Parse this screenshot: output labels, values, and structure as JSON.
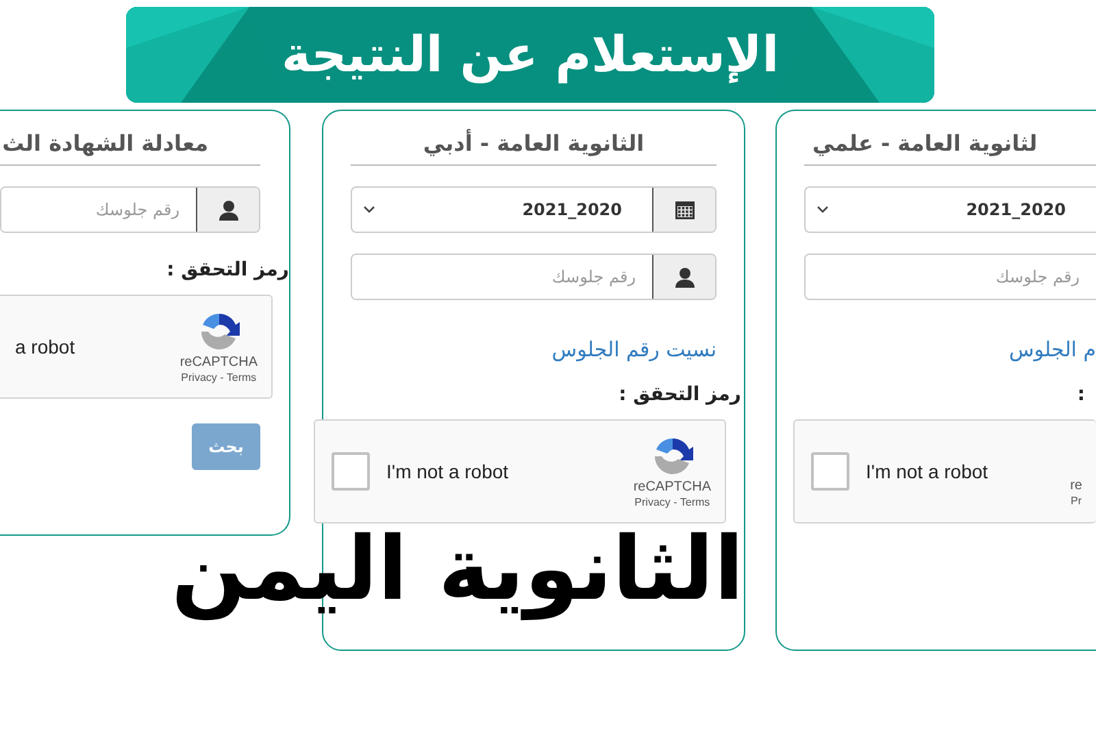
{
  "banner": {
    "title": "الإستعلام عن النتيجة"
  },
  "cards": [
    {
      "title": "لثانوية العامة - علمي",
      "year": "2021_2020",
      "seat_placeholder": "رقم جلوسك",
      "forgot_link": "م الجلوس",
      "captcha_label": ":",
      "captcha": {
        "checked": false,
        "text": "I'm not a robot",
        "logo": false,
        "brand": "re",
        "links": "Pr"
      }
    },
    {
      "title": "الثانوية العامة - أدبي",
      "year": "2021_2020",
      "seat_placeholder": "رقم جلوسك",
      "forgot_link": "نسيت رقم الجلوس",
      "captcha_label": "رمز التحقق :",
      "captcha": {
        "checked": false,
        "text": "I'm not a robot",
        "logo": true,
        "brand": "reCAPTCHA",
        "links": "Privacy - Terms"
      }
    },
    {
      "title": "معادلة الشهادة الث",
      "seat_placeholder": "رقم جلوسك",
      "captcha_label": "رمز التحقق :",
      "captcha": {
        "text": "a robot",
        "logo": true,
        "brand": "reCAPTCHA",
        "links": "Privacy - Terms"
      },
      "search_button": "بحث"
    }
  ],
  "headline": "الثانوية اليمن"
}
